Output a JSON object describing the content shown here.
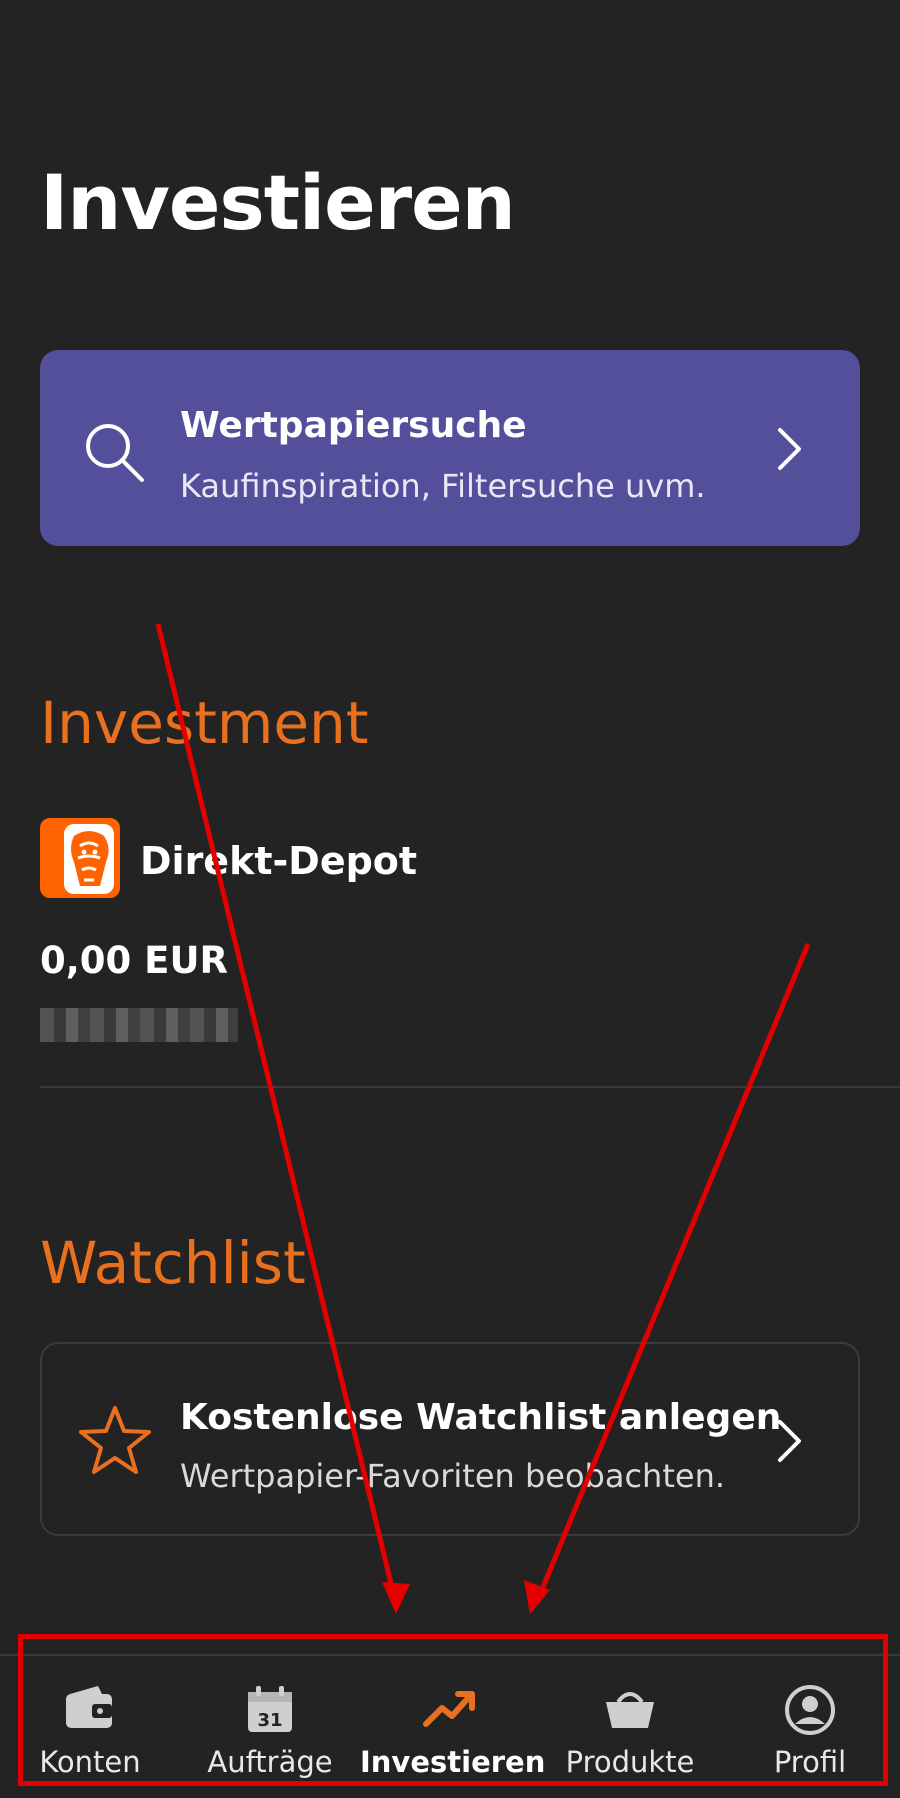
{
  "page": {
    "title": "Investieren"
  },
  "search_card": {
    "title": "Wertpapiersuche",
    "subtitle": "Kaufinspiration, Filtersuche uvm.",
    "icon": "search-icon",
    "accent": "#534f9b"
  },
  "investment": {
    "section_title": "Investment",
    "depot_name": "Direkt-Depot",
    "amount": "0,00 EUR",
    "logo": "ing-lion-logo",
    "accent": "#e9701f"
  },
  "watchlist": {
    "section_title": "Watchlist",
    "card_title": "Kostenlose Watchlist anlegen",
    "card_subtitle": "Wertpapier-Favoriten beobachten.",
    "icon": "star-icon"
  },
  "nav": {
    "items": [
      {
        "label": "Konten",
        "icon": "wallet-icon"
      },
      {
        "label": "Aufträge",
        "icon": "calendar-icon",
        "badge": "31"
      },
      {
        "label": "Investieren",
        "icon": "trend-up-icon",
        "active": true
      },
      {
        "label": "Produkte",
        "icon": "basket-icon"
      },
      {
        "label": "Profil",
        "icon": "profile-icon"
      }
    ]
  },
  "annotation": {
    "color": "#e40000"
  }
}
